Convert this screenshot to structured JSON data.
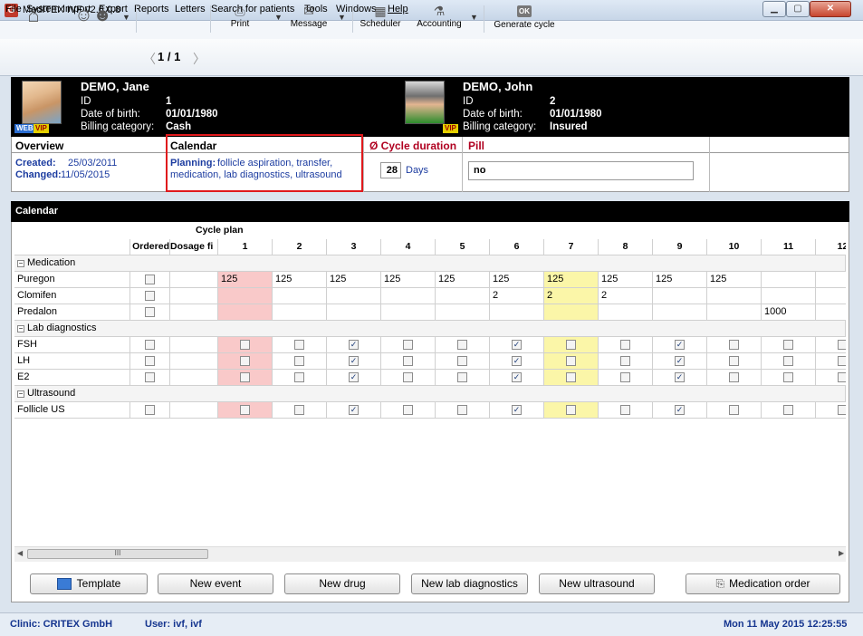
{
  "window": {
    "title": "MedITEX IVF v2.6.0.8",
    "app_icon": "G"
  },
  "menu": [
    "File",
    "System",
    "Import",
    "Export",
    "Reports",
    "Letters",
    "Search for patients",
    "Tools",
    "Windows",
    "Help"
  ],
  "toolbar": {
    "pager": "1 / 1",
    "print": "Print",
    "message": "Message",
    "scheduler": "Scheduler",
    "accounting": "Accounting",
    "generate_cycle": "Generate cycle",
    "ok_badge": "OK"
  },
  "patient_female": {
    "name": "DEMO, Jane",
    "id_label": "ID",
    "id": "1",
    "dob_label": "Date of birth:",
    "dob": "01/01/1980",
    "billing_label": "Billing category:",
    "billing": "Cash",
    "badge_web": "WEB",
    "badge_vip": "VIP"
  },
  "patient_male": {
    "name": "DEMO, John",
    "id_label": "ID",
    "id": "2",
    "dob_label": "Date of birth:",
    "dob": "01/01/1980",
    "billing_label": "Billing category:",
    "billing": "Insured",
    "badge_vip": "VIP"
  },
  "overview": {
    "title": "Overview",
    "created_label": "Created:",
    "created": "25/03/2011",
    "changed_label": "Changed:",
    "changed": "11/05/2015"
  },
  "calendar_info": {
    "title": "Calendar",
    "planning_label": "Planning:",
    "planning_line1": "follicle aspiration, transfer,",
    "planning_line2": "medication, lab diagnostics, ultrasound"
  },
  "cycle_duration": {
    "title": "Ø Cycle duration",
    "value": "28",
    "unit": "Days"
  },
  "pill": {
    "title": "Pill",
    "value": "no"
  },
  "calendar": {
    "title": "Calendar",
    "cycle_plan_label": "Cycle plan",
    "col_ordered": "Ordered",
    "col_dosage": "Dosage fi",
    "days": [
      "1",
      "2",
      "3",
      "4",
      "5",
      "6",
      "7",
      "8",
      "9",
      "10",
      "11",
      "12"
    ],
    "groups": [
      {
        "label": "Medication",
        "rows": [
          {
            "name": "Puregon",
            "type": "value",
            "values": [
              "125",
              "125",
              "125",
              "125",
              "125",
              "125",
              "125",
              "125",
              "125",
              "125",
              "",
              ""
            ]
          },
          {
            "name": "Clomifen",
            "type": "value",
            "values": [
              "",
              "",
              "",
              "",
              "",
              "2",
              "2",
              "2",
              "",
              "",
              "",
              ""
            ]
          },
          {
            "name": "Predalon",
            "type": "value",
            "values": [
              "",
              "",
              "",
              "",
              "",
              "",
              "",
              "",
              "",
              "",
              "1000",
              ""
            ]
          }
        ]
      },
      {
        "label": "Lab diagnostics",
        "rows": [
          {
            "name": "FSH",
            "type": "check",
            "checks": [
              false,
              false,
              true,
              false,
              false,
              true,
              false,
              false,
              true,
              false,
              false,
              false
            ]
          },
          {
            "name": "LH",
            "type": "check",
            "checks": [
              false,
              false,
              true,
              false,
              false,
              true,
              false,
              false,
              true,
              false,
              false,
              false
            ]
          },
          {
            "name": "E2",
            "type": "check",
            "checks": [
              false,
              false,
              true,
              false,
              false,
              true,
              false,
              false,
              true,
              false,
              false,
              false
            ]
          }
        ]
      },
      {
        "label": "Ultrasound",
        "rows": [
          {
            "name": "Follicle US",
            "type": "check",
            "checks": [
              false,
              false,
              true,
              false,
              false,
              true,
              false,
              false,
              true,
              false,
              false,
              false
            ]
          }
        ]
      }
    ],
    "scroll_grip": "III"
  },
  "buttons": {
    "template": "Template",
    "new_event": "New event",
    "new_drug": "New drug",
    "new_lab": "New lab diagnostics",
    "new_ultrasound": "New ultrasound",
    "medication_order": "Medication order"
  },
  "status": {
    "clinic": "Clinic: CRITEX GmbH",
    "user": "User: ivf, ivf",
    "datetime": "Mon 11 May 2015 12:25:55"
  },
  "colors": {
    "day1_highlight": "#f9c9c9",
    "today_highlight": "#fbf6a8",
    "link_blue": "#1c3ca0",
    "header_red": "#b00020"
  }
}
